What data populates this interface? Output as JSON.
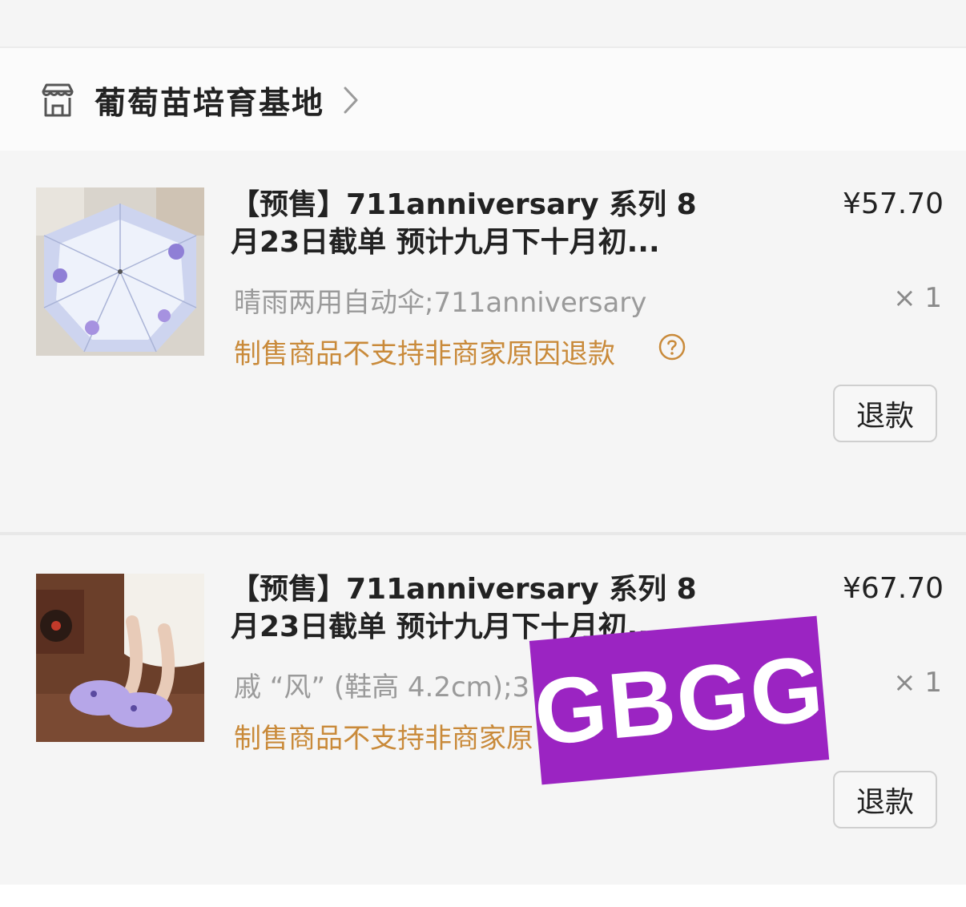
{
  "shop": {
    "name": "葡萄苗培育基地"
  },
  "orders": [
    {
      "title": "【预售】711anniversary 系列 8月23日截单 预计九月下十月初...",
      "price": "¥57.70",
      "spec": "晴雨两用自动伞;711anniversary",
      "qty": "× 1",
      "notice": "制售商品不支持非商家原因退款",
      "refund_label": "退款",
      "thumb_icon": "umbrella-product-image"
    },
    {
      "title": "【预售】711anniversary 系列 8月23日截单 预计九月下十月初...",
      "price": "¥67.70",
      "spec": "戚 “风” (鞋高 4.2cm);3",
      "qty": "× 1",
      "notice": "制售商品不支持非商家原",
      "refund_label": "退款",
      "thumb_icon": "clog-shoes-product-image"
    }
  ],
  "watermark": {
    "text": "GBGG",
    "color": "#9b24c2"
  },
  "colors": {
    "notice": "#c98a3a",
    "muted": "#9a9a9a"
  }
}
